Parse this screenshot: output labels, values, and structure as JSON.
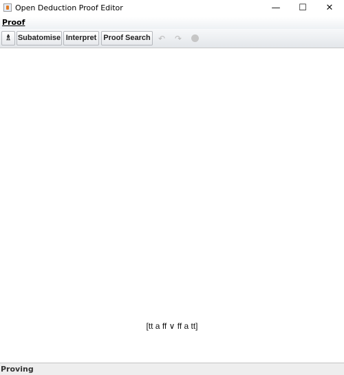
{
  "window": {
    "title": "Open Deduction Proof Editor",
    "controls": {
      "minimize": "—",
      "maximize": "☐",
      "close": "✕"
    }
  },
  "menubar": {
    "items": [
      {
        "label": "Proof"
      }
    ]
  },
  "toolbar": {
    "buttons": [
      {
        "icon": "tree-icon",
        "glyph": "♗"
      },
      {
        "label": "Subatomise"
      },
      {
        "label": "Interpret"
      },
      {
        "label": "Proof Search"
      }
    ],
    "disabled_icons": [
      {
        "icon": "undo-icon",
        "glyph": "↶"
      },
      {
        "icon": "redo-icon",
        "glyph": "↷"
      },
      {
        "icon": "stop-icon"
      }
    ]
  },
  "canvas": {
    "formula": "[tt a ff ∨ ff a tt]"
  },
  "status": {
    "text": "Proving"
  }
}
